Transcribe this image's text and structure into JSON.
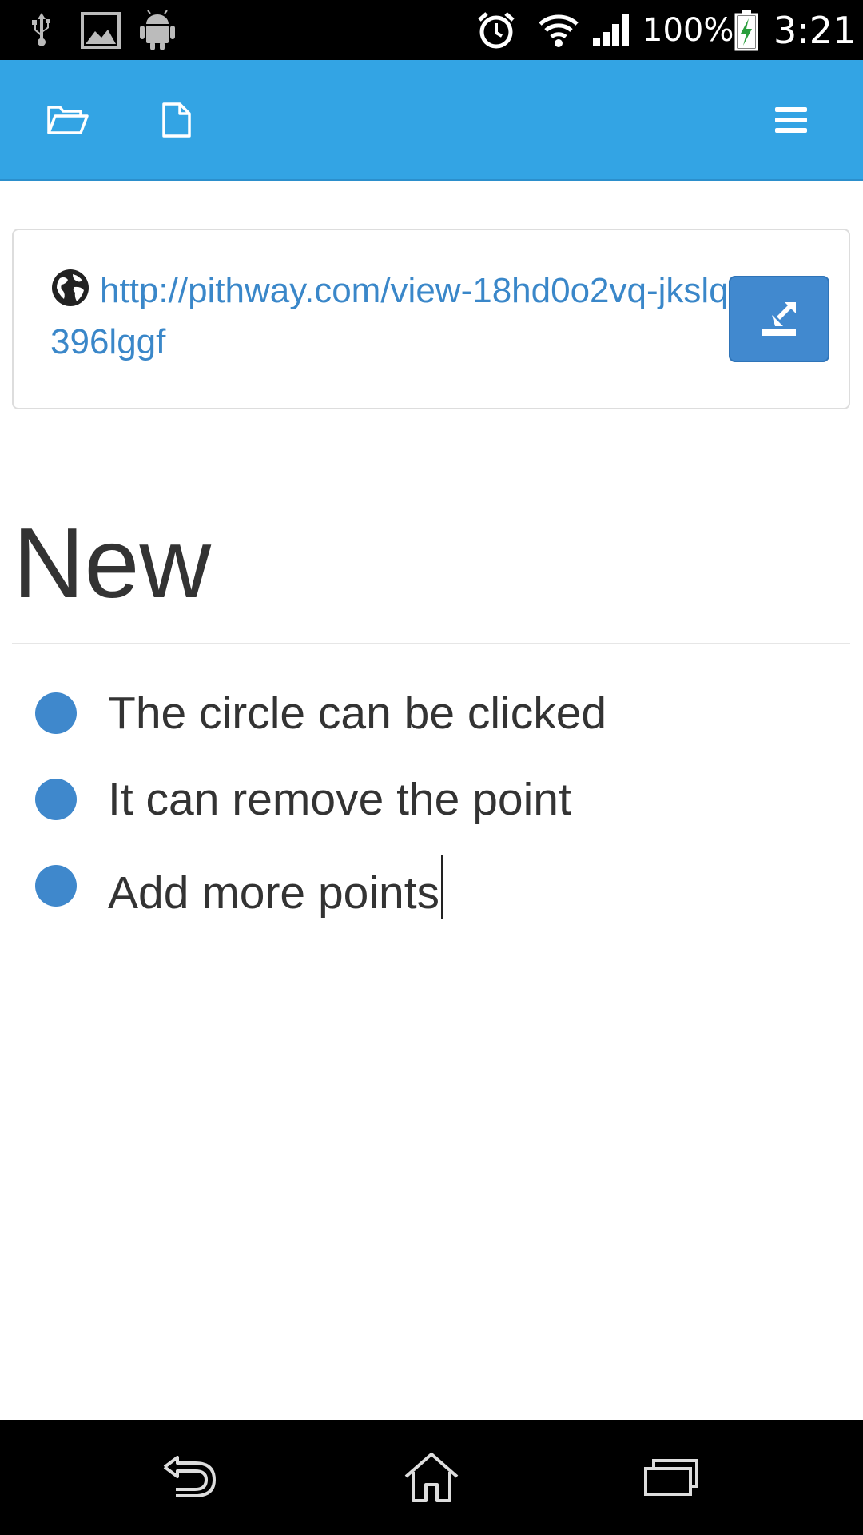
{
  "status_bar": {
    "battery_percent": "100%",
    "time": "3:21",
    "icons": [
      "usb-icon",
      "gallery-icon",
      "android-icon",
      "alarm-icon",
      "wifi-icon",
      "signal-icon",
      "battery-charging-icon"
    ]
  },
  "toolbar": {
    "icons": [
      "folder-open-icon",
      "file-icon",
      "menu-icon"
    ]
  },
  "url_card": {
    "url": "http://pithway.com/view-18hd0o2vq-jkslq396lggf",
    "icon": "globe-icon",
    "action_icon": "edit-icon"
  },
  "document": {
    "title": "New",
    "points": [
      "The circle can be clicked",
      "It can remove the point",
      "Add more points"
    ]
  },
  "nav_bar": {
    "icons": [
      "back-icon",
      "home-icon",
      "recent-apps-icon"
    ]
  },
  "colors": {
    "app_bar": "#33a4e4",
    "accent": "#3f88cc",
    "link": "#3a87c9",
    "text": "#333333"
  }
}
